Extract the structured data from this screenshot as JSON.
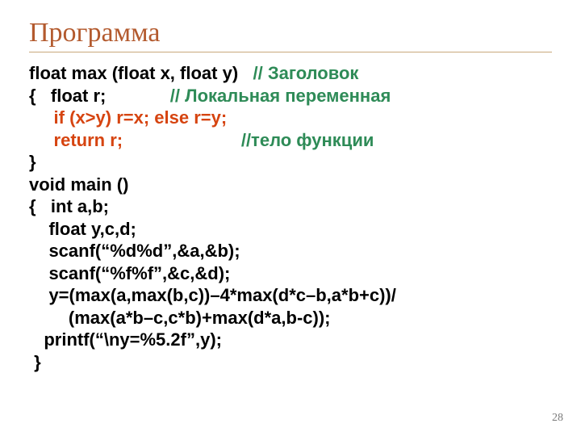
{
  "title": "Программа",
  "page_number": "28",
  "code": {
    "l1a": "float max (float x, float y)   ",
    "l1b": "// Заголовок",
    "l2a": "{   float r;             ",
    "l2b": "// Локальная переменная",
    "l3": "     if (x>y) r=x; else r=y;",
    "l4a": "     return r;",
    "l4pad": "                        ",
    "l4b": "//тело функции",
    "l5": "}",
    "l6": "void main ()",
    "l7": "{   int a,b;",
    "l8": "    float y,c,d;",
    "l9": "    scanf(“%d%d”,&a,&b);",
    "l10": "    scanf(“%f%f”,&c,&d);",
    "l11": "    y=(max(a,max(b,c))–4*max(d*c–b,a*b+c))/",
    "l12": "        (max(a*b–c,c*b)+max(d*a,b-c));",
    "l13": "   printf(“\\ny=%5.2f”,y);",
    "l14": " }"
  }
}
